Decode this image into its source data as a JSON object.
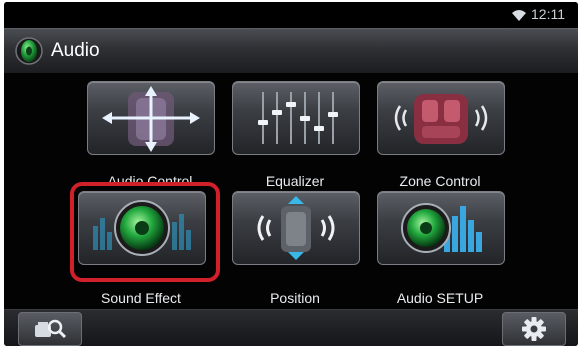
{
  "status_bar": {
    "wifi_icon": "wifi-icon",
    "time": "12:11"
  },
  "header": {
    "icon": "speaker-icon",
    "title": "Audio"
  },
  "menu": {
    "items": [
      {
        "label": "Audio Control",
        "icon": "audio-control-icon"
      },
      {
        "label": "Equalizer",
        "icon": "equalizer-icon"
      },
      {
        "label": "Zone Control",
        "icon": "zone-control-icon"
      },
      {
        "label": "Sound Effect",
        "icon": "sound-effect-icon",
        "highlighted": true
      },
      {
        "label": "Position",
        "icon": "position-icon"
      },
      {
        "label": "Audio SETUP",
        "icon": "audio-setup-icon"
      }
    ]
  },
  "bottom_bar": {
    "left_button_icon": "source-search-icon",
    "right_button_icon": "gear-icon"
  },
  "colors": {
    "highlight": "#d0202a",
    "accent_green": "#2fb64a"
  }
}
